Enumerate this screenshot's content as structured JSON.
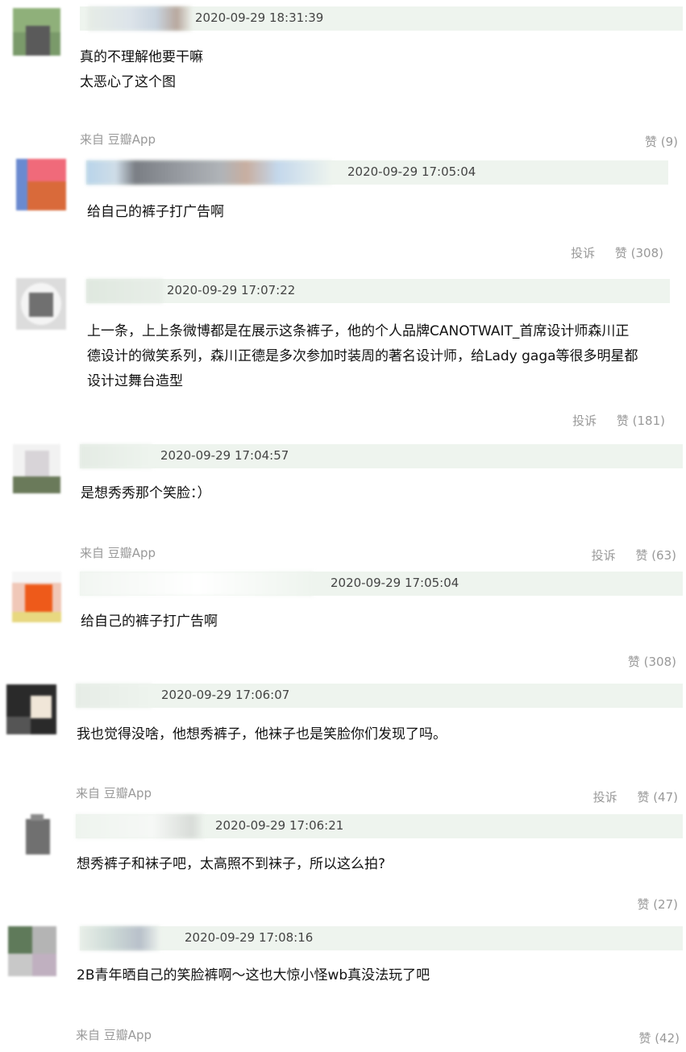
{
  "comments": [
    {
      "time": "2020-09-29 18:31:39",
      "text": "真的不理解他要干嘛\n太恶心了这个图",
      "source": "来自 豆瓣App",
      "report": "",
      "like": "赞 (9)"
    },
    {
      "time": "2020-09-29 17:05:04",
      "text": "给自己的裤子打广告啊",
      "source": "",
      "report": "投诉",
      "like": "赞 (308)"
    },
    {
      "time": "2020-09-29 17:07:22",
      "text": "上一条，上上条微博都是在展示这条裤子，他的个人品牌CANOTWAIT_首席设计师森川正\n德设计的微笑系列，森川正德是多次参加时装周的著名设计师，给Lady gaga等很多明星都\n设计过舞台造型",
      "source": "",
      "report": "投诉",
      "like": "赞 (181)"
    },
    {
      "time": "2020-09-29 17:04:57",
      "text": "是想秀秀那个笑脸：）",
      "source": "来自 豆瓣App",
      "report": "投诉",
      "like": "赞 (63)"
    },
    {
      "time": "2020-09-29 17:05:04",
      "text": "给自己的裤子打广告啊",
      "source": "",
      "report": "",
      "like": "赞 (308)"
    },
    {
      "time": "2020-09-29 17:06:07",
      "text": "我也觉得没啥，他想秀裤子，他袜子也是笑脸你们发现了吗。",
      "source": "来自 豆瓣App",
      "report": "投诉",
      "like": "赞 (47)"
    },
    {
      "time": "2020-09-29 17:06:21",
      "text": "想秀裤子和袜子吧，太高照不到袜子，所以这么拍?",
      "source": "",
      "report": "",
      "like": "赞 (27)"
    },
    {
      "time": "2020-09-29 17:08:16",
      "text": "2B青年晒自己的笑脸裤啊～这也大惊小怪wb真没法玩了吧",
      "source": "来自 豆瓣App",
      "report": "",
      "like": "赞 (42)"
    }
  ]
}
